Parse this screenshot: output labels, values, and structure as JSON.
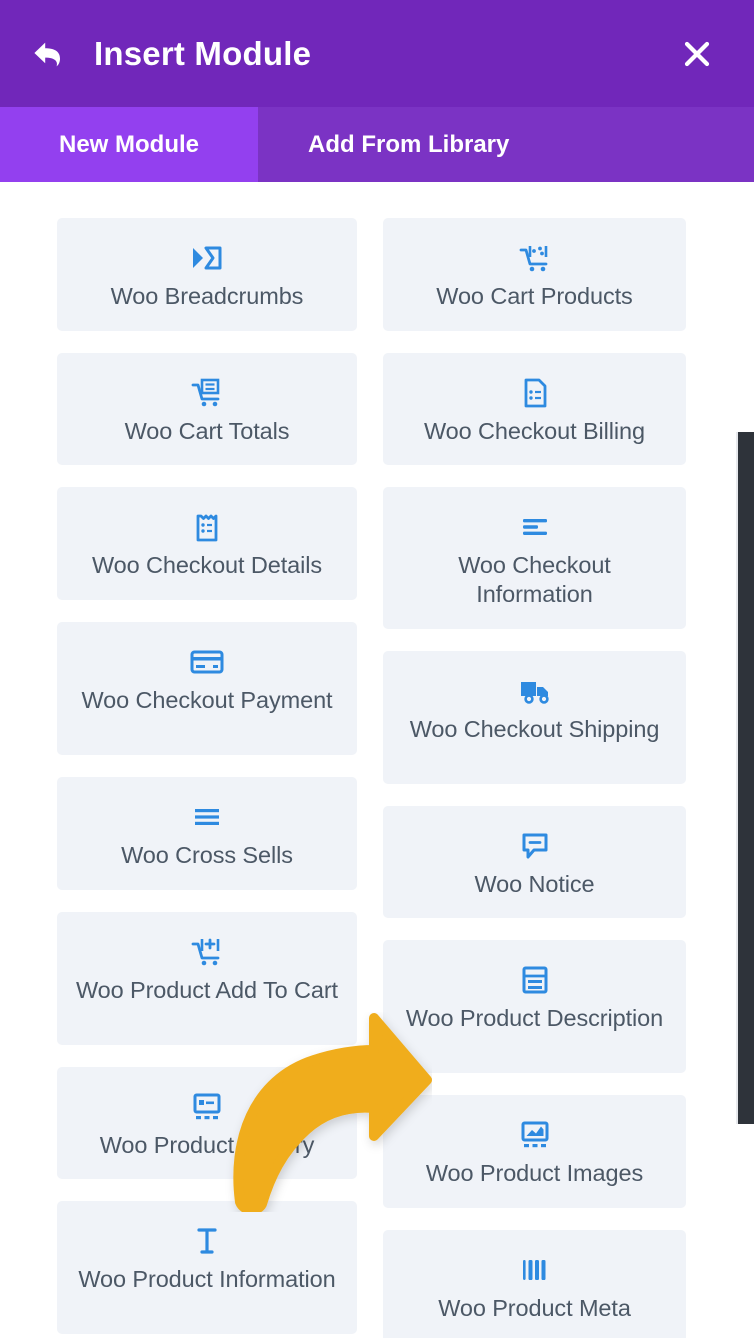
{
  "header": {
    "title": "Insert Module",
    "back_icon": "back-arrow-icon",
    "close_icon": "close-icon"
  },
  "tabs": [
    {
      "id": "new-module",
      "label": "New Module",
      "active": true
    },
    {
      "id": "add-from-library",
      "label": "Add From Library",
      "active": false
    }
  ],
  "modules": {
    "left_column": [
      {
        "label": "Woo Breadcrumbs",
        "icon": "breadcrumbs-icon",
        "lines": 1
      },
      {
        "label": "Woo Cart Totals",
        "icon": "cart-totals-icon",
        "lines": 1
      },
      {
        "label": "Woo Checkout Details",
        "icon": "checkout-details-icon",
        "lines": 1
      },
      {
        "label": "Woo Checkout Payment",
        "icon": "credit-card-icon",
        "lines": 2
      },
      {
        "label": "Woo Cross Sells",
        "icon": "list-lines-icon",
        "lines": 1
      },
      {
        "label": "Woo Product Add To Cart",
        "icon": "cart-add-icon",
        "lines": 2
      },
      {
        "label": "Woo Product Gallery",
        "icon": "gallery-icon",
        "lines": 1
      },
      {
        "label": "Woo Product Information",
        "icon": "text-cursor-icon",
        "lines": 2
      }
    ],
    "right_column": [
      {
        "label": "Woo Cart Products",
        "icon": "cart-products-icon",
        "lines": 1
      },
      {
        "label": "Woo Checkout Billing",
        "icon": "billing-document-icon",
        "lines": 1
      },
      {
        "label": "Woo Checkout Information",
        "icon": "align-lines-icon",
        "lines": 2
      },
      {
        "label": "Woo Checkout Shipping",
        "icon": "shipping-truck-icon",
        "lines": 2
      },
      {
        "label": "Woo Notice",
        "icon": "notice-bubble-icon",
        "lines": 1
      },
      {
        "label": "Woo Product Description",
        "icon": "description-icon",
        "lines": 2
      },
      {
        "label": "Woo Product Images",
        "icon": "images-icon",
        "lines": 1
      },
      {
        "label": "Woo Product Meta",
        "icon": "barcode-icon",
        "lines": 1
      }
    ]
  },
  "scrollbar": {
    "name": "vertical-scrollbar"
  },
  "annotation": {
    "name": "highlight-arrow",
    "color": "#f0ad1d",
    "points_to": "Woo Product Images"
  },
  "colors": {
    "header_purple": "#7127ba",
    "tabbar_purple": "#7b33c4",
    "active_tab_purple": "#9340ef",
    "tile_bg": "#f0f3f8",
    "tile_text": "#4c5866",
    "icon_blue": "#2e8ae0",
    "scrollbar": "#2e333a",
    "arrow_orange": "#f0ad1d"
  }
}
